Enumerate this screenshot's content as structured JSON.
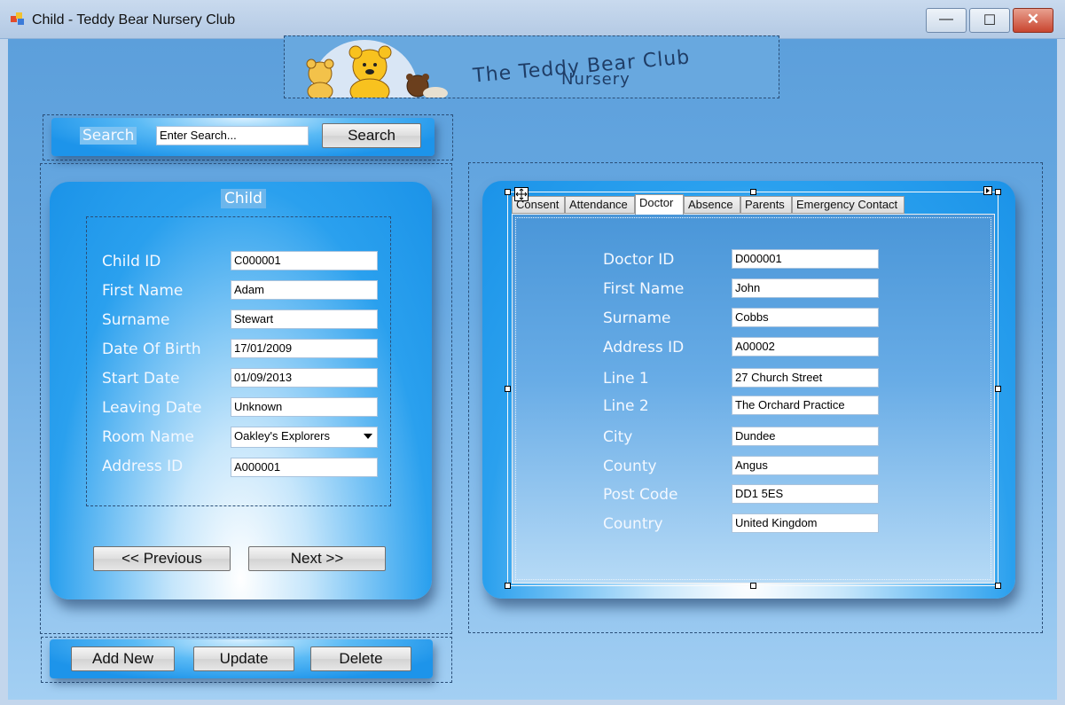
{
  "window": {
    "title": "Child - Teddy Bear Nursery Club",
    "min_glyph": "—",
    "max_glyph": "☐",
    "close_glyph": "✕"
  },
  "logo": {
    "line1": "The Teddy Bear Club",
    "line2": "Nursery"
  },
  "search": {
    "label": "Search",
    "input_value": "Enter Search...",
    "button": "Search"
  },
  "child": {
    "title": "Child",
    "fields": [
      {
        "label": "Child ID",
        "value": "C000001"
      },
      {
        "label": "First Name",
        "value": "Adam"
      },
      {
        "label": "Surname",
        "value": "Stewart"
      },
      {
        "label": "Date Of Birth",
        "value": "17/01/2009"
      },
      {
        "label": "Start Date",
        "value": "01/09/2013"
      },
      {
        "label": "Leaving Date",
        "value": "Unknown"
      },
      {
        "label": "Room Name",
        "value": "Oakley's Explorers"
      },
      {
        "label": "Address ID",
        "value": "A000001"
      }
    ],
    "prev_button": "<< Previous",
    "next_button": "Next >>"
  },
  "actions": {
    "add": "Add New",
    "update": "Update",
    "delete": "Delete"
  },
  "tabs": [
    "Consent",
    "Attendance",
    "Doctor",
    "Absence",
    "Parents",
    "Emergency Contact"
  ],
  "active_tab": "Doctor",
  "doctor": {
    "fields": [
      {
        "label": "Doctor ID",
        "value": "D000001"
      },
      {
        "label": "First Name",
        "value": "John"
      },
      {
        "label": "Surname",
        "value": "Cobbs"
      },
      {
        "label": "Address ID",
        "value": "A00002"
      },
      {
        "label": "Line 1",
        "value": "27 Church Street"
      },
      {
        "label": "Line 2",
        "value": "The Orchard Practice"
      },
      {
        "label": "City",
        "value": "Dundee"
      },
      {
        "label": "County",
        "value": "Angus"
      },
      {
        "label": "Post Code",
        "value": "DD1 5ES"
      },
      {
        "label": "Country",
        "value": "United Kingdom"
      }
    ]
  },
  "colors": {
    "accent": "#1b93e8",
    "client_bg": "#5c9fdb",
    "label_text": "#f3f8ff"
  }
}
